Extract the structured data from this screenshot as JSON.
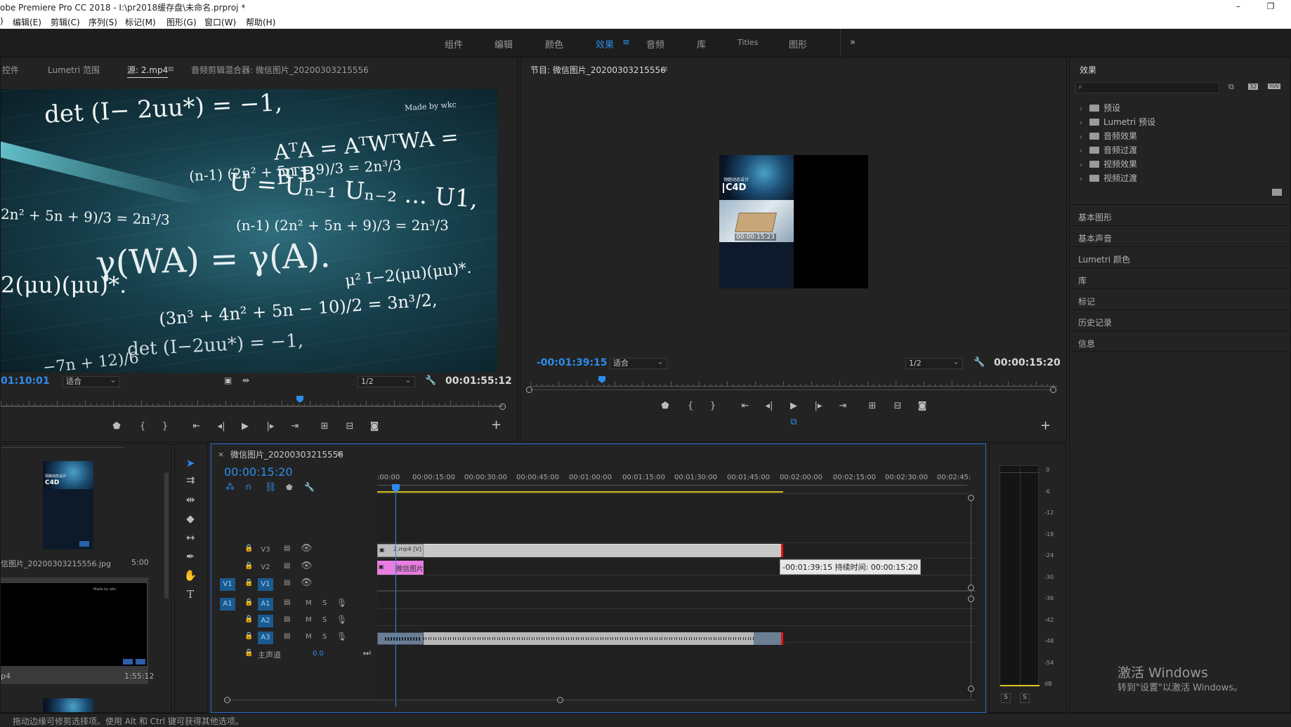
{
  "window": {
    "title": "obe Premiere Pro CC 2018 - I:\\pr2018缓存盘\\未命名.prproj *",
    "minimize": "–",
    "restore": "❐"
  },
  "menu": {
    "items": [
      ")",
      "编辑(E)",
      "剪辑(C)",
      "序列(S)",
      "标记(M)",
      "图形(G)",
      "窗口(W)",
      "帮助(H)"
    ]
  },
  "workspaces": {
    "items": [
      "组件",
      "编辑",
      "颜色",
      "效果",
      "音频",
      "库",
      "Titles",
      "图形"
    ],
    "active_index": 3,
    "menu_icon": "≡",
    "overflow": "»"
  },
  "source_panel": {
    "tabs": [
      "控件",
      "Lumetri 范围",
      "源: 2.mp4",
      "音频剪辑混合器: 微信图片_20200303215556"
    ],
    "active_tab": 2,
    "menu_icon": "≡",
    "timecode_left": "01:10:01",
    "fit": "适合",
    "resolution": "1/2",
    "timecode_right": "00:01:55:12",
    "add": "+",
    "video": {
      "formulas": [
        "det (I− 2uu*) = −1,",
        "AᵀA = AᵀWᵀWA = BᵀB",
        "(n-1) (2n² + 5n + 9)/3 = 2n³/3",
        "U = Uₙ₋₁ Uₙ₋₂ ... U1,",
        "2n² + 5n + 9)/3 = 2n³/3",
        "(n-1) (2n² + 5n + 9)/3 = 2n³/3",
        "γ(WA) = γ(A).",
        "2(μu)(μu)*.",
        "μ² I−2(μu)(μu)*.",
        "(3n³ + 4n² + 5n − 10)/2 = 3n³/2,",
        "det (I−2uu*) = −1,",
        "−7n + 12)/6",
        "Made by wkc"
      ]
    }
  },
  "program_panel": {
    "title": "节目: 微信图片_20200303215556",
    "menu_icon": "≡",
    "timecode_left": "-00:01:39:15",
    "fit": "适合",
    "resolution": "1/2",
    "timecode_right": "00:00:15:20",
    "add": "+",
    "preview": {
      "overlay_text": "领跑动态设计",
      "brand": "C4D",
      "timestamp": "00:00:15:23"
    }
  },
  "effects_panel": {
    "title": "效果",
    "search_placeholder": "",
    "tree": [
      "预设",
      "Lumetri 预设",
      "音频效果",
      "音频过渡",
      "视频效果",
      "视频过渡"
    ],
    "sections": [
      "基本图形",
      "基本声音",
      "Lumetri 颜色",
      "库",
      "标记",
      "历史记录",
      "信息"
    ],
    "buttons": [
      "⧉",
      "32",
      "YUV"
    ]
  },
  "project_panel": {
    "items": [
      {
        "name": "信图片_20200303215556.jpg",
        "duration": "5:00",
        "thumb_text": "领跑动态设计",
        "thumb_brand": "C4D"
      },
      {
        "name": "p4",
        "duration": "1:55:12",
        "thumb_text": "Made by wkc"
      }
    ]
  },
  "timeline": {
    "close": "×",
    "title": "微信图片_20200303215556",
    "menu_icon": "≡",
    "timecode": "00:00:15:20",
    "ruler_labels": [
      ":00:00",
      "00:00:15:00",
      "00:00:30:00",
      "00:00:45:00",
      "00:01:00:00",
      "00:01:15:00",
      "00:01:30:00",
      "00:01:45:00",
      "00:02:00:00",
      "00:02:15:00",
      "00:02:30:00",
      "00:02:45:"
    ],
    "tracks": {
      "video": [
        {
          "name": "V3",
          "source": ""
        },
        {
          "name": "V2",
          "source": ""
        },
        {
          "name": "V1",
          "source": "V1"
        }
      ],
      "audio": [
        {
          "name": "A1",
          "source": "A1"
        },
        {
          "name": "A2",
          "source": ""
        },
        {
          "name": "A3",
          "source": ""
        }
      ],
      "audio_buttons": {
        "mute": "M",
        "solo": "S"
      },
      "master_label": "主声道",
      "master_value": "0.0"
    },
    "clips": {
      "v3_label": "2.mp4 [V]",
      "v2_label": "微信图片",
      "tooltip": "-00:01:39:15 持续时间: 00:00:15:20"
    }
  },
  "audio_meter": {
    "scale": [
      "0",
      "-6",
      "-12",
      "-18",
      "-24",
      "-30",
      "-36",
      "-42",
      "-48",
      "-54",
      "dB"
    ],
    "solo_buttons": [
      "S",
      "S"
    ]
  },
  "watermark": {
    "line1": "激活 Windows",
    "line2": "转到\"设置\"以激活 Windows。"
  },
  "status_bar": {
    "text": "拖动边缘可修剪选择项。使用 Alt 和 Ctrl 键可获得其他选项。"
  }
}
